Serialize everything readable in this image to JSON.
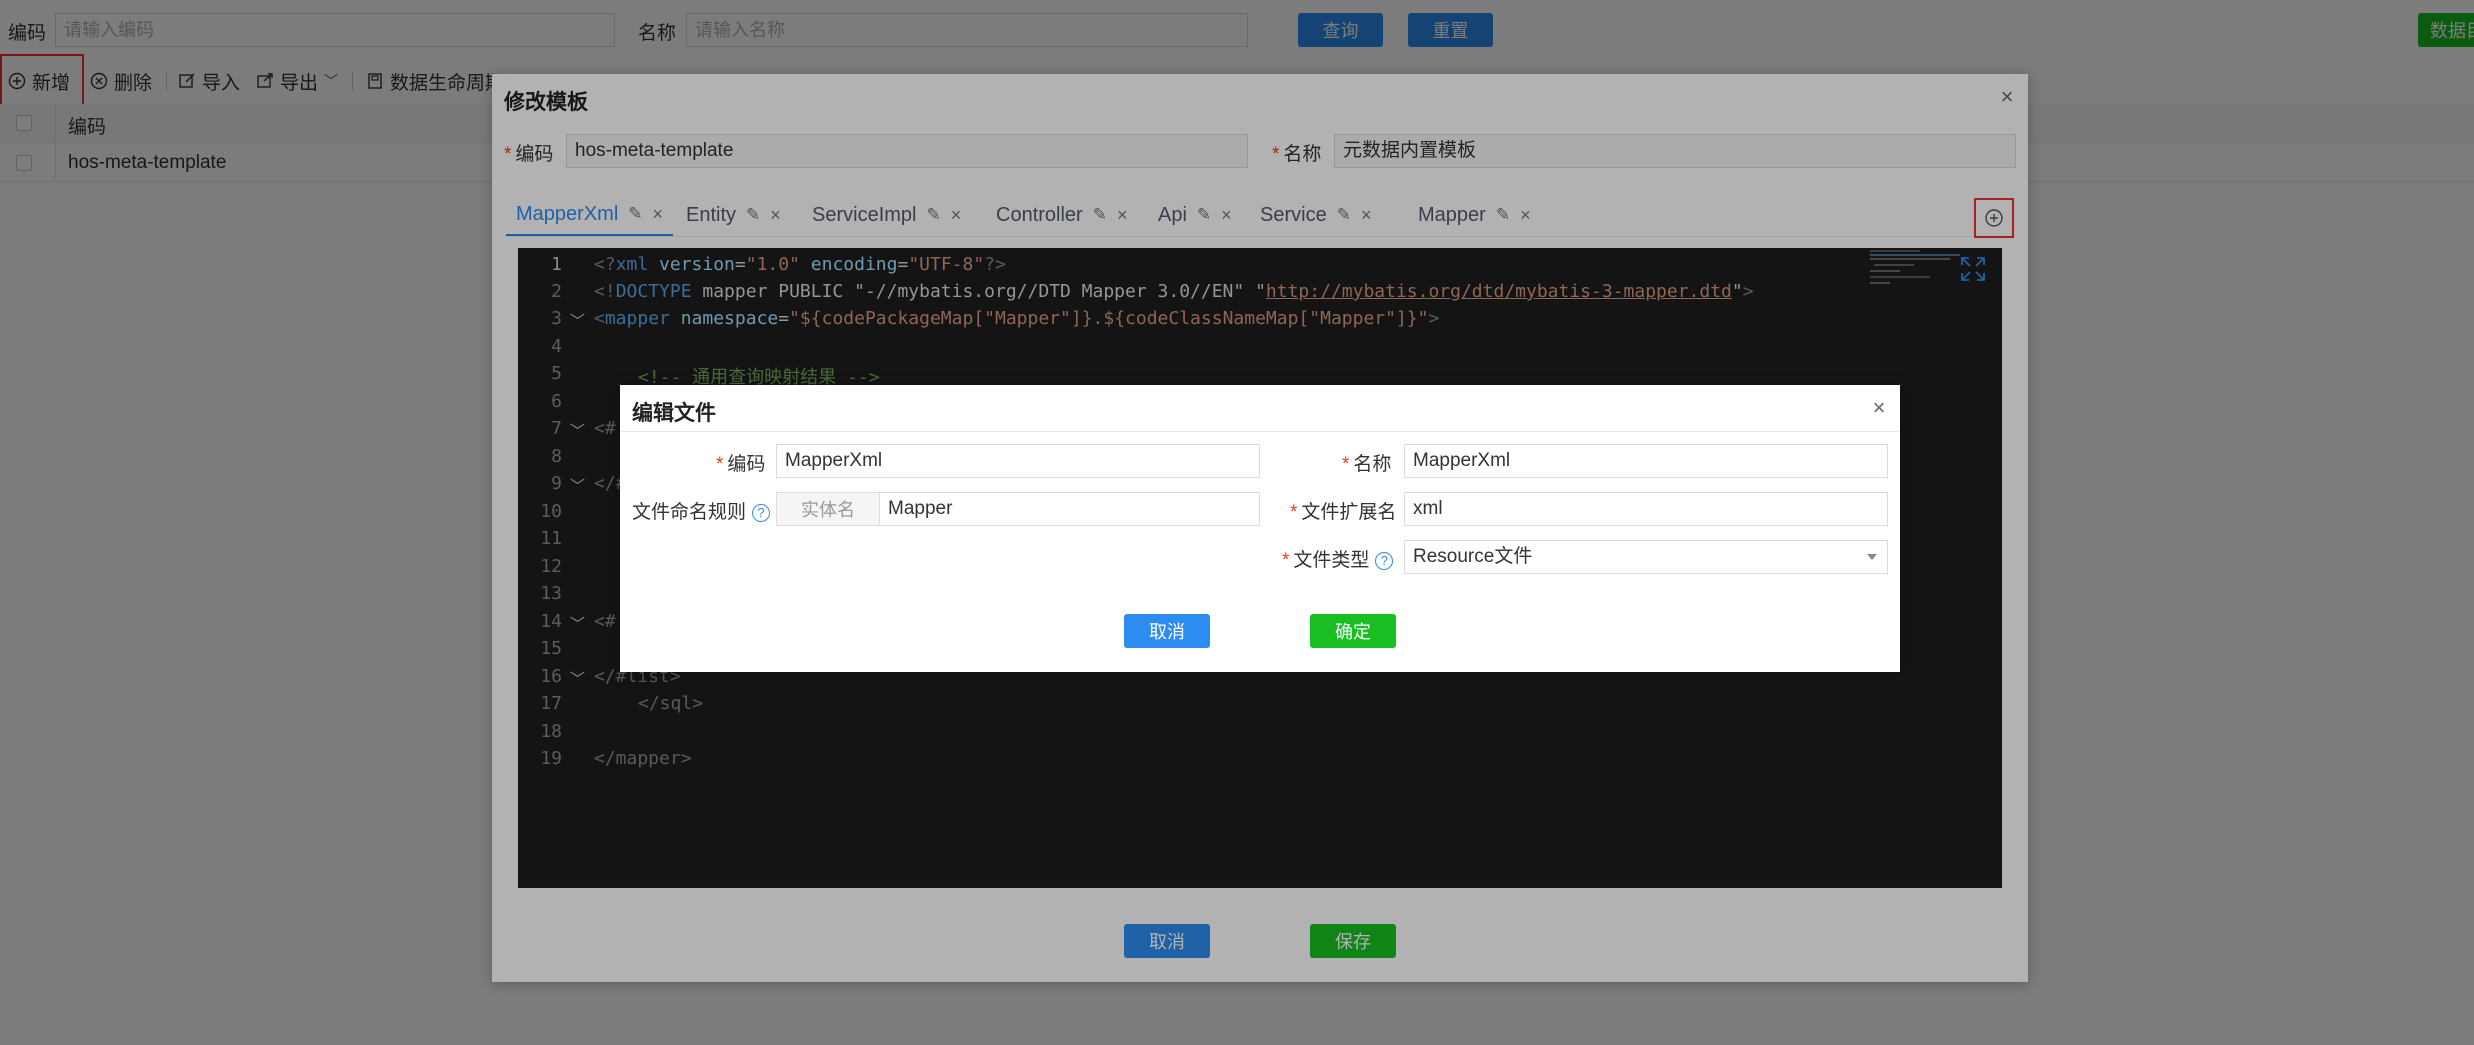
{
  "search": {
    "code_label": "编码",
    "code_placeholder": "请输入编码",
    "name_label": "名称",
    "name_placeholder": "请输入名称",
    "query_button": "查询",
    "reset_button": "重置",
    "right_button_partial": "数据目"
  },
  "toolbar": {
    "add": "新增",
    "delete": "删除",
    "import": "导入",
    "export": "导出",
    "lifecycle": "数据生命周期"
  },
  "table": {
    "header_code": "编码",
    "rows": [
      "hos-meta-template"
    ]
  },
  "modal_template": {
    "title": "修改模板",
    "code_label": "编码",
    "code_value": "hos-meta-template",
    "name_label": "名称",
    "name_value": "元数据内置模板",
    "tabs": [
      "MapperXml",
      "Entity",
      "ServiceImpl",
      "Controller",
      "Api",
      "Service",
      "Mapper"
    ],
    "active_tab": "MapperXml",
    "cancel_button": "取消",
    "save_button": "保存"
  },
  "editor": {
    "line_numbers": [
      "1",
      "2",
      "3",
      "4",
      "5",
      "6",
      "7",
      "8",
      "9",
      "10",
      "11",
      "12",
      "13",
      "14",
      "15",
      "16",
      "17",
      "18",
      "19"
    ],
    "line1": {
      "a": "<?",
      "b": "xml",
      "c": " version",
      "d": "=",
      "e": "\"1.0\"",
      "f": " encoding",
      "g": "=",
      "h": "\"UTF-8\"",
      "i": "?>"
    },
    "line2": {
      "a": "<!",
      "b": "DOCTYPE",
      "c": " mapper PUBLIC \"-//mybatis.org//DTD Mapper 3.0//EN\" \"",
      "d": "http://mybatis.org/dtd/mybatis-3-mapper.dtd",
      "e": "\"",
      "f": ">"
    },
    "line3": {
      "a": "<",
      "b": "mapper",
      "c": " namespace",
      "d": "=",
      "e": "\"${codePackageMap[\"Mapper\"]}.${codeClassNameMap[\"Mapper\"]}\"",
      "f": ">"
    },
    "line5": "<!-- 通用查询映射结果 -->",
    "line7": "<#",
    "line9": "</#",
    "line14": "<#",
    "line16": "</#list>",
    "line17": "</sql>",
    "line19": "</mapper>"
  },
  "modal_file": {
    "title": "编辑文件",
    "code_label": "编码",
    "code_value": "MapperXml",
    "name_label": "名称",
    "name_value": "MapperXml",
    "naming_rule_label": "文件命名规则",
    "naming_rule_prefix": "实体名",
    "naming_rule_value": "Mapper",
    "ext_label": "文件扩展名",
    "ext_value": "xml",
    "type_label": "文件类型",
    "type_value": "Resource文件",
    "cancel_button": "取消",
    "ok_button": "确定"
  },
  "colors": {
    "primary": "#2d8cf0",
    "success": "#19be23",
    "required": "#ed4014",
    "editor_bg": "#1e1e1e"
  }
}
